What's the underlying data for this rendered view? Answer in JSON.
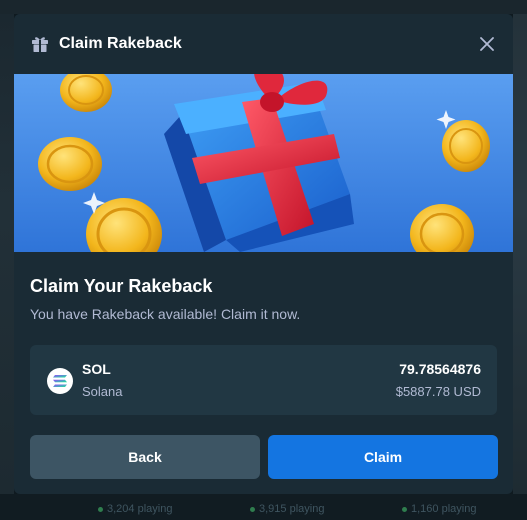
{
  "modal": {
    "title": "Claim Rakeback",
    "icon": "gift-icon",
    "close_icon": "close-icon",
    "heading": "Claim Your Rakeback",
    "subtext": "You have Rakeback available! Claim it now."
  },
  "currency": {
    "code": "SOL",
    "name": "Solana",
    "amount": "79.78564876",
    "usd": "$5887.78 USD",
    "icon": "solana-icon"
  },
  "buttons": {
    "back_label": "Back",
    "claim_label": "Claim"
  },
  "background": {
    "players": [
      "3,204 playing",
      "3,915 playing",
      "1,160 playing"
    ]
  },
  "colors": {
    "modal_bg": "#1a2b35",
    "card_bg": "#213743",
    "back_button": "#3d5564",
    "claim_button": "#1475e1",
    "muted_text": "#b1bad3"
  }
}
